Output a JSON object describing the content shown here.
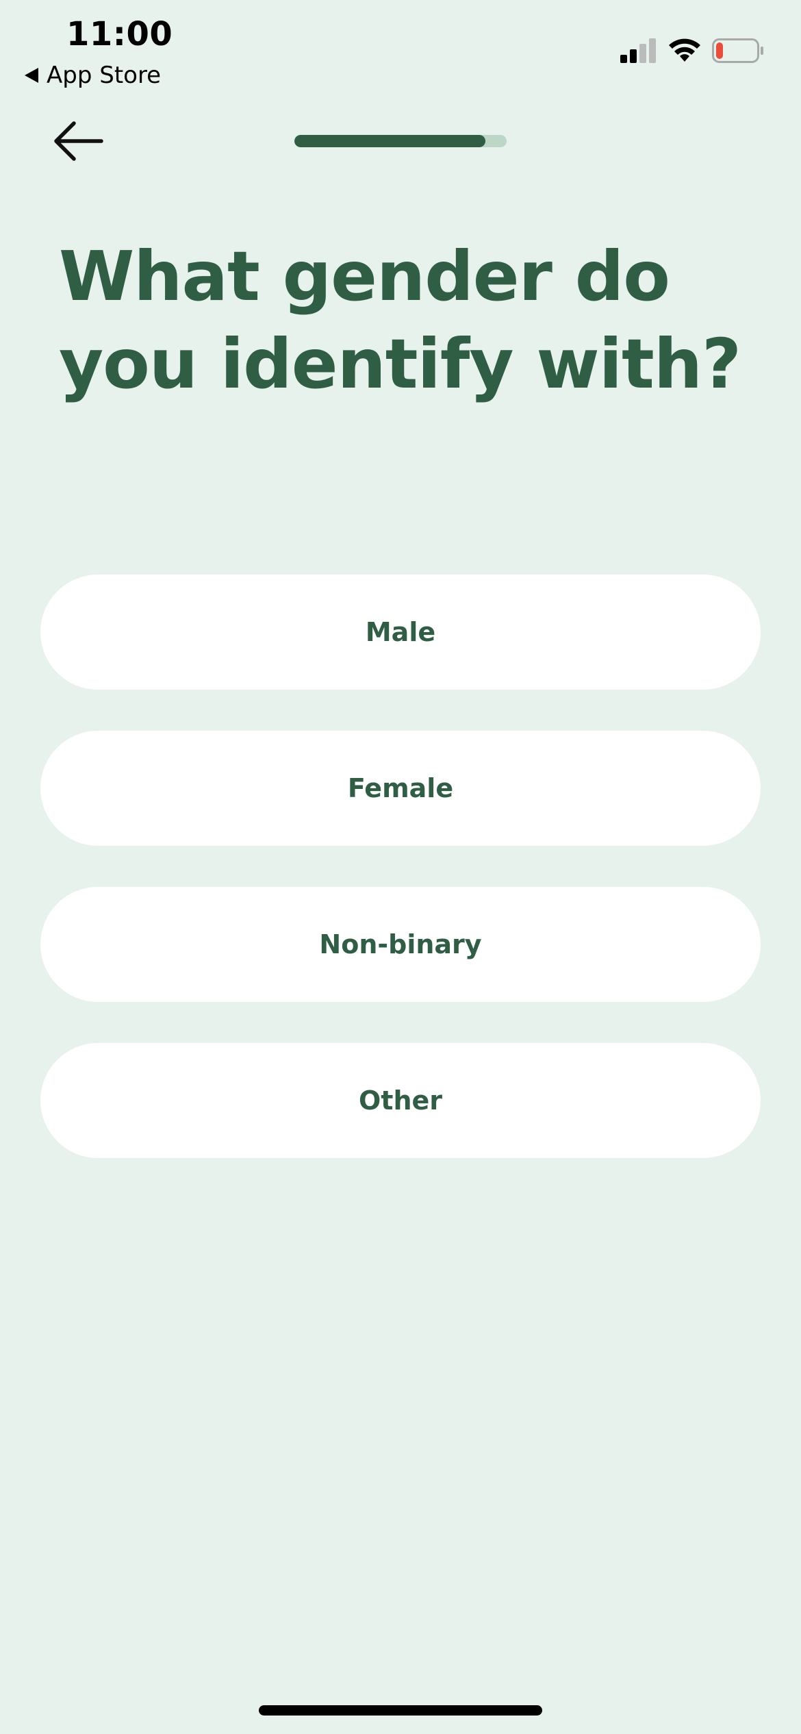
{
  "status_bar": {
    "time": "11:00",
    "back_app_label": "App Store",
    "signal_icon": "cellular-signal-icon",
    "wifi_icon": "wifi-icon",
    "battery_icon": "battery-low-icon",
    "battery_level_fraction": 0.08,
    "battery_color": "#eb4d3d"
  },
  "nav": {
    "back_icon": "arrow-left-icon",
    "progress_fraction": 0.9
  },
  "question": {
    "title": "What gender do you identify with?"
  },
  "options": [
    {
      "label": "Male"
    },
    {
      "label": "Female"
    },
    {
      "label": "Non-binary"
    },
    {
      "label": "Other"
    }
  ],
  "colors": {
    "background": "#e8f2ed",
    "accent": "#2f5e45",
    "progress_track": "#bcd7c8",
    "option_background": "#ffffff"
  }
}
